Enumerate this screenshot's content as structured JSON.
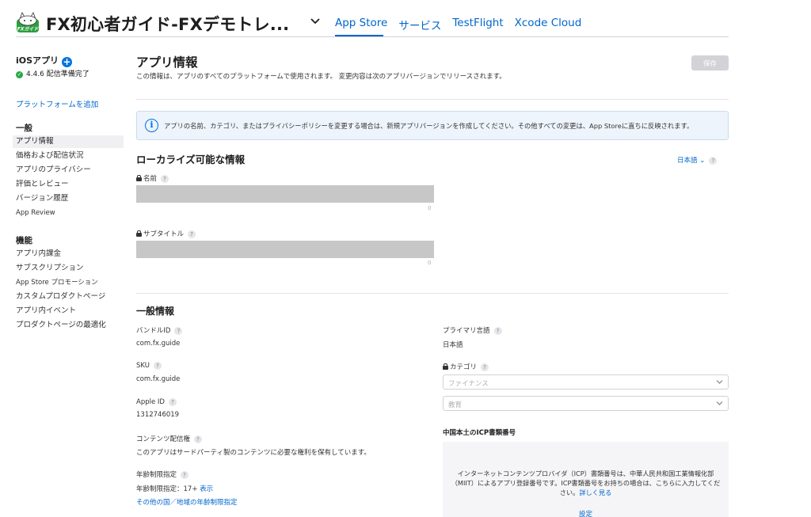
{
  "header": {
    "app_title": "FX初心者ガイド-FXデモトレ...",
    "icon_label": "FXガイド",
    "tabs": [
      {
        "label": "App Store"
      },
      {
        "label": "サービス"
      },
      {
        "label": "TestFlight"
      },
      {
        "label": "Xcode Cloud"
      }
    ]
  },
  "sidebar": {
    "platform": "iOSアプリ",
    "version_status": "4.4.6 配信準備完了",
    "add_platform": "プラットフォームを追加",
    "section_general": "一般",
    "general_items": [
      {
        "label": "アプリ情報"
      },
      {
        "label": "価格および配信状況"
      },
      {
        "label": "アプリのプライバシー"
      },
      {
        "label": "評価とレビュー"
      },
      {
        "label": "バージョン履歴"
      },
      {
        "label": "App Review"
      }
    ],
    "section_features": "機能",
    "feature_items": [
      {
        "label": "アプリ内課金"
      },
      {
        "label": "サブスクリプション"
      },
      {
        "label": "App Store プロモーション"
      },
      {
        "label": "カスタムプロダクトページ"
      },
      {
        "label": "アプリ内イベント"
      },
      {
        "label": "プロダクトページの最適化"
      }
    ]
  },
  "main": {
    "title": "アプリ情報",
    "description": "この情報は、アプリのすべてのプラットフォームで使用されます。 変更内容は次のアプリバージョンでリリースされます。",
    "save_label": "保存",
    "info_banner": "アプリの名前、カテゴリ、またはプライバシーポリシーを変更する場合は、新規アプリバージョンを作成してください。その他すべての変更は、App Storeに直ちに反映されます。",
    "localizable": {
      "title": "ローカライズ可能な情報",
      "language": "日本語",
      "name_label": "名前",
      "name_count": "0",
      "subtitle_label": "サブタイトル",
      "subtitle_count": "0"
    },
    "general": {
      "title": "一般情報",
      "bundle_id_label": "バンドルID",
      "bundle_id_value": "com.fx.guide",
      "sku_label": "SKU",
      "sku_value": "com.fx.guide",
      "apple_id_label": "Apple ID",
      "apple_id_value": "1312746019",
      "content_rights_label": "コンテンツ配信権",
      "content_rights_value": "このアプリはサードパーティ製のコンテンツに必要な権利を保有しています。",
      "age_rating_label": "年齢制限指定",
      "age_rating_value": "年齢制限指定：17+",
      "age_rating_link": "表示",
      "other_regions_link": "その他の国／地域の年齢制限指定",
      "primary_language_label": "プライマリ言語",
      "primary_language_value": "日本語",
      "category_label": "カテゴリ",
      "category_primary": "ファイナンス",
      "category_secondary": "教育",
      "icp_title": "中国本土のICP書類番号",
      "icp_text": "インターネットコンテンツプロバイダ（ICP）書類番号は、中華人民共和国工業情報化部（MIIT）によるアプリ登録番号です。ICP書類番号をお持ちの場合は、こちらに入力してください。",
      "icp_learn_more": "詳しく見る",
      "icp_setting": "設定"
    }
  },
  "colors": {
    "accent": "#0066cc",
    "plus_button": "#0071e3",
    "ready_status": "#28a745",
    "info_bg": "#eef4fb"
  }
}
